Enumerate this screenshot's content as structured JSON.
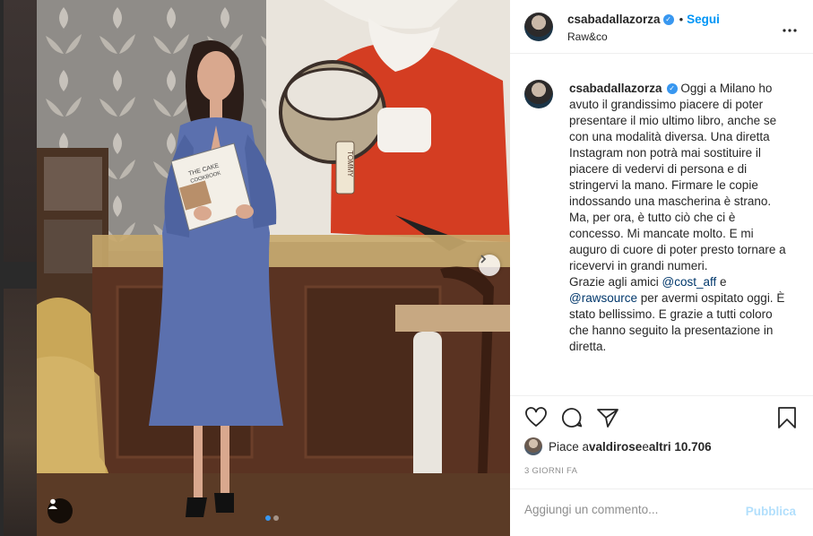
{
  "post": {
    "username": "csabadallazorza",
    "follow_label": "Segui",
    "dot": "•",
    "location": "Raw&co",
    "more_label": "•••"
  },
  "caption": {
    "username": "csabadallazorza",
    "text_1": "Oggi a Milano ho avuto il grandissimo piacere di poter presentare il mio ultimo libro, anche se con una modalità diversa. Una diretta Instagram non potrà mai sostituire il piacere di vedervi di persona e di stringervi la mano. Firmare le copie indossando una mascherina è strano. Ma, per ora, è tutto ciò che ci è concesso. Mi mancate molto. E mi auguro di cuore di poter presto tornare a ricevervi in grandi numeri.",
    "text_2": "Grazie agli amici ",
    "mention_1": "@cost_aff",
    "text_3": " e ",
    "mention_2": "@rawsource",
    "text_4": " per avermi ospitato oggi. È stato bellissimo. E grazie a tutti coloro che hanno seguito la presentazione in diretta."
  },
  "likes": {
    "prefix": "Piace a ",
    "user": "valdirose",
    "middle": " e ",
    "others": "altri 10.706"
  },
  "time_ago": "3 GIORNI FA",
  "comment_input": {
    "placeholder": "Aggiungi un commento..."
  },
  "publish_label": "Pubblica",
  "photo_book_cover": {
    "title": "THE CAKE",
    "subtitle": "COOKBOOK"
  },
  "photo_tag_text": "TOMMY",
  "icons": {
    "verified": "verified-badge-icon",
    "next": "chevron-right-icon",
    "user_tag": "user-icon",
    "like": "heart-icon",
    "comment": "comment-bubble-icon",
    "share": "paper-plane-icon",
    "save": "bookmark-icon"
  },
  "colors": {
    "accent": "#0095f6",
    "verified": "#3897f0",
    "publish_disabled": "#b2dffc",
    "muted": "#8e8e8e"
  },
  "carousel": {
    "slides": 2,
    "active_index": 0
  }
}
